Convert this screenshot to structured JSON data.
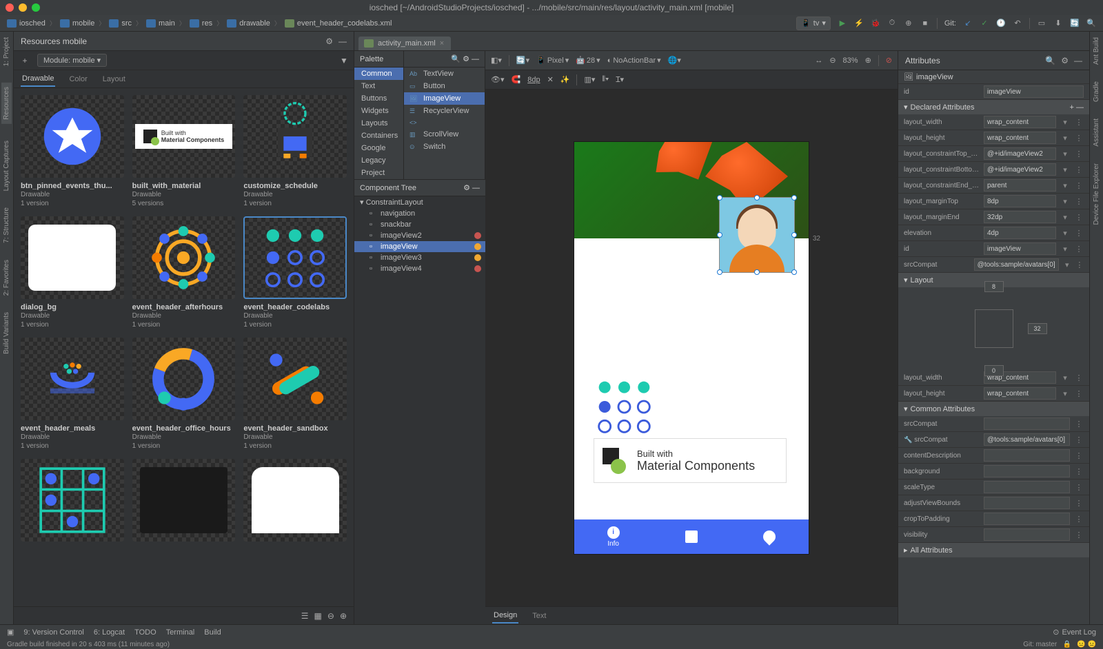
{
  "window": {
    "title": "iosched [~/AndroidStudioProjects/iosched] - .../mobile/src/main/res/layout/activity_main.xml [mobile]"
  },
  "breadcrumbs": [
    "iosched",
    "mobile",
    "src",
    "main",
    "res",
    "drawable"
  ],
  "breadcrumb_file": "event_header_codelabs.xml",
  "toolbar": {
    "device": "tv",
    "git_label": "Git:"
  },
  "sidebar_left": [
    "1: Project",
    "Resources",
    "Layout Captures",
    "7: Structure",
    "2: Favorites",
    "Build Variants"
  ],
  "sidebar_right": [
    "Ant Build",
    "Gradle",
    "Assistant",
    "Device File Explorer"
  ],
  "resources": {
    "title": "Resources  mobile",
    "module": "Module: mobile",
    "tabs": [
      "Drawable",
      "Color",
      "Layout"
    ],
    "active_tab": "Drawable",
    "cards": [
      {
        "name": "btn_pinned_events_thu...",
        "type": "Drawable",
        "versions": "1 version"
      },
      {
        "name": "built_with_material",
        "type": "Drawable",
        "versions": "5 versions"
      },
      {
        "name": "customize_schedule",
        "type": "Drawable",
        "versions": "1 version"
      },
      {
        "name": "dialog_bg",
        "type": "Drawable",
        "versions": "1 version"
      },
      {
        "name": "event_header_afterhours",
        "type": "Drawable",
        "versions": "1 version"
      },
      {
        "name": "event_header_codelabs",
        "type": "Drawable",
        "versions": "1 version",
        "selected": true
      },
      {
        "name": "event_header_meals",
        "type": "Drawable",
        "versions": "1 version"
      },
      {
        "name": "event_header_office_hours",
        "type": "Drawable",
        "versions": "1 version"
      },
      {
        "name": "event_header_sandbox",
        "type": "Drawable",
        "versions": "1 version"
      }
    ]
  },
  "file_tab": "activity_main.xml",
  "palette": {
    "title": "Palette",
    "categories": [
      "Common",
      "Text",
      "Buttons",
      "Widgets",
      "Layouts",
      "Containers",
      "Google",
      "Legacy",
      "Project"
    ],
    "active": "Common",
    "widgets": [
      "TextView",
      "Button",
      "ImageView",
      "RecyclerView",
      "<fragment>",
      "ScrollView",
      "Switch"
    ],
    "selected_widget": "ImageView"
  },
  "tree": {
    "title": "Component Tree",
    "root": "ConstraintLayout",
    "items": [
      {
        "name": "navigation",
        "err": null
      },
      {
        "name": "snackbar",
        "err": null
      },
      {
        "name": "imageView2",
        "err": "red"
      },
      {
        "name": "imageView",
        "err": "yel",
        "selected": true
      },
      {
        "name": "imageView3",
        "err": "yel"
      },
      {
        "name": "imageView4",
        "err": "red"
      }
    ]
  },
  "design_toolbar": {
    "device": "Pixel",
    "api": "28",
    "theme": "NoActionBar",
    "zoom": "83%",
    "dp": "8dp"
  },
  "design_surface": {
    "margin_right": "32",
    "built_with_line1": "Built with",
    "built_with_line2": "Material Components",
    "nav_info": "Info"
  },
  "design_tabs": [
    "Design",
    "Text"
  ],
  "attributes": {
    "title": "Attributes",
    "type_label": "imageView",
    "id_label": "id",
    "id_value": "imageView",
    "declared_hdr": "Declared Attributes",
    "layout_hdr": "Layout",
    "common_hdr": "Common Attributes",
    "all_hdr": "All Attributes",
    "declared": [
      {
        "k": "layout_width",
        "v": "wrap_content"
      },
      {
        "k": "layout_height",
        "v": "wrap_content"
      },
      {
        "k": "layout_constraintTop_toE",
        "v": "@+id/imageView2"
      },
      {
        "k": "layout_constraintBottom_",
        "v": "@+id/imageView2"
      },
      {
        "k": "layout_constraintEnd_toE",
        "v": "parent"
      },
      {
        "k": "layout_marginTop",
        "v": "8dp"
      },
      {
        "k": "layout_marginEnd",
        "v": "32dp"
      },
      {
        "k": "elevation",
        "v": "4dp"
      },
      {
        "k": "id",
        "v": "imageView"
      },
      {
        "k": "srcCompat",
        "v": "@tools:sample/avatars[0]"
      }
    ],
    "layout_margins": {
      "top": "8",
      "right": "32",
      "bottom": "0"
    },
    "layout_size": [
      {
        "k": "layout_width",
        "v": "wrap_content"
      },
      {
        "k": "layout_height",
        "v": "wrap_content"
      }
    ],
    "common": [
      {
        "k": "srcCompat",
        "v": ""
      },
      {
        "k": "srcCompat",
        "v": "@tools:sample/avatars[0]",
        "tools": true
      },
      {
        "k": "contentDescription",
        "v": ""
      },
      {
        "k": "background",
        "v": ""
      },
      {
        "k": "scaleType",
        "v": ""
      },
      {
        "k": "adjustViewBounds",
        "v": ""
      },
      {
        "k": "cropToPadding",
        "v": ""
      },
      {
        "k": "visibility",
        "v": ""
      }
    ]
  },
  "statusbar": {
    "items": [
      "9: Version Control",
      "6: Logcat",
      "TODO",
      "Terminal",
      "Build"
    ],
    "event_log": "Event Log"
  },
  "bottom": {
    "build_msg": "Gradle build finished in 20 s 403 ms (11 minutes ago)",
    "git": "Git: master"
  }
}
